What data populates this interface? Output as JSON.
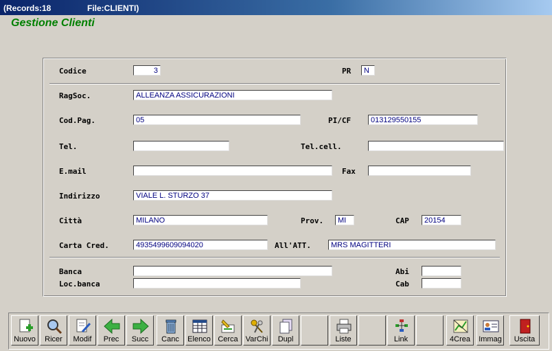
{
  "titlebar": {
    "records": "(Records:18",
    "file": "File:CLIENTI)"
  },
  "app_title": "Gestione Clienti",
  "form": {
    "codice": {
      "label": "Codice",
      "value": "3"
    },
    "pr": {
      "label": "PR",
      "value": "N"
    },
    "ragsoc": {
      "label": "RagSoc.",
      "value": "ALLEANZA ASSICURAZIONI"
    },
    "codpag": {
      "label": "Cod.Pag.",
      "value": "05"
    },
    "picf": {
      "label": "PI/CF",
      "value": "013129550155"
    },
    "tel": {
      "label": "Tel.",
      "value": ""
    },
    "telcell": {
      "label": "Tel.cell.",
      "value": ""
    },
    "email": {
      "label": "E.mail",
      "value": ""
    },
    "fax": {
      "label": "Fax",
      "value": ""
    },
    "indirizzo": {
      "label": "Indirizzo",
      "value": "VIALE L. STURZO 37"
    },
    "citta": {
      "label": "Città",
      "value": "MILANO"
    },
    "prov": {
      "label": "Prov.",
      "value": "MI"
    },
    "cap": {
      "label": "CAP",
      "value": "20154"
    },
    "cartacred": {
      "label": "Carta Cred.",
      "value": "4935499609094020"
    },
    "allatt": {
      "label": "All'ATT.",
      "value": "MRS MAGITTERI"
    },
    "banca": {
      "label": "Banca",
      "value": ""
    },
    "abi": {
      "label": "Abi",
      "value": ""
    },
    "locbanca": {
      "label": "Loc.banca",
      "value": ""
    },
    "cab": {
      "label": "Cab",
      "value": ""
    }
  },
  "toolbar": {
    "nuovo": "Nuovo",
    "ricer": "Ricer",
    "modif": "Modif",
    "prec": "Prec",
    "succ": "Succ",
    "canc": "Canc",
    "elenco": "Elenco",
    "cerca": "Cerca",
    "varchi": "VarChi",
    "dupl": "Dupl",
    "liste": "Liste",
    "link": "Link",
    "crea4": "4Crea",
    "immag": "Immag",
    "uscita": "Uscita"
  },
  "colors": {
    "title_green": "#008000",
    "field_text": "#000080",
    "face": "#d4d0c8"
  }
}
